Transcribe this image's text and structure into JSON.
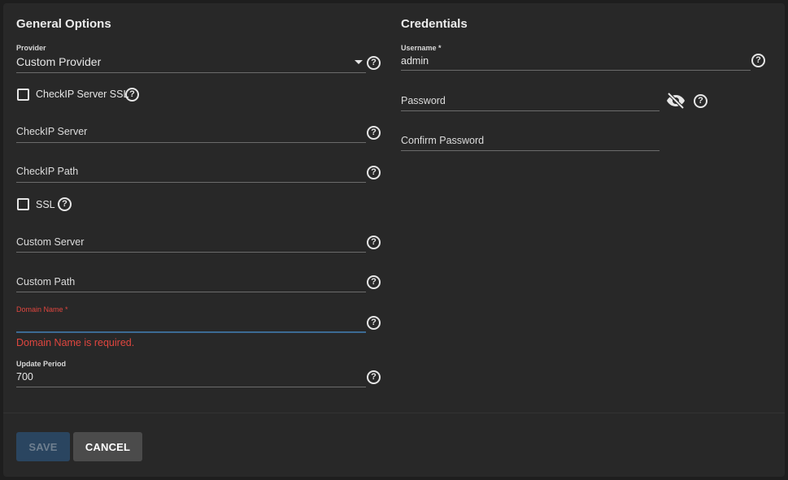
{
  "general": {
    "title": "General Options",
    "provider": {
      "label": "Provider",
      "value": "Custom Provider"
    },
    "checkip_ssl": {
      "label": "CheckIP Server SSL",
      "checked": false
    },
    "checkip_server": {
      "placeholder": "CheckIP Server"
    },
    "checkip_path": {
      "placeholder": "CheckIP Path"
    },
    "ssl": {
      "label": "SSL",
      "checked": false
    },
    "custom_server": {
      "placeholder": "Custom Server"
    },
    "custom_path": {
      "placeholder": "Custom Path"
    },
    "domain_name": {
      "label": "Domain Name *",
      "value": "",
      "error": "Domain Name is required."
    },
    "update_period": {
      "label": "Update Period",
      "value": "700"
    }
  },
  "credentials": {
    "title": "Credentials",
    "username": {
      "label": "Username *",
      "value": "admin"
    },
    "password": {
      "placeholder": "Password"
    },
    "confirm_password": {
      "placeholder": "Confirm Password"
    }
  },
  "actions": {
    "save_label": "SAVE",
    "cancel_label": "CANCEL"
  },
  "icons": {
    "help": "help-circle-icon",
    "visibility": "eye-off-icon",
    "dropdown": "caret-down-icon"
  },
  "colors": {
    "background": "#1e1e1e",
    "card": "#282828",
    "error": "#e0463f",
    "focus_underline": "#3c6b94",
    "save_button": "#2a4560",
    "cancel_button": "#4b4b4b"
  }
}
